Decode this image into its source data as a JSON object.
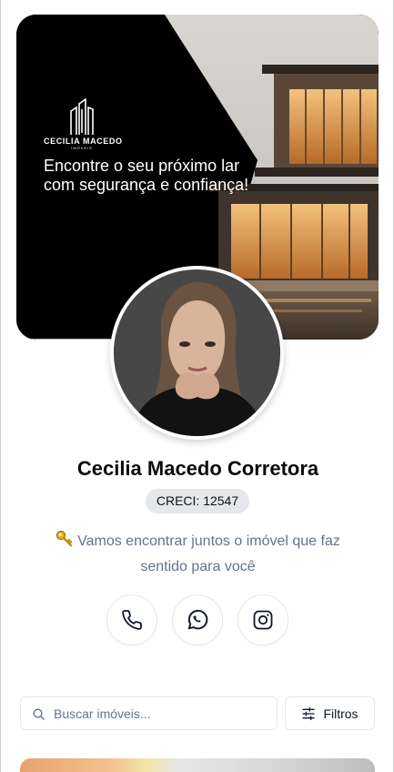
{
  "profile": {
    "name": "Cecilia Macedo Corretora",
    "creci": "CRECI: 12547",
    "bio": "Vamos encontrar juntos o imóvel que faz sentido para você",
    "bio_icon": "key-icon"
  },
  "banner": {
    "logo_name": "CECILIA MACEDO",
    "logo_sub": "IMÓVEIS",
    "tagline": "Encontre o seu próximo lar com segurança e confiança!"
  },
  "social": [
    {
      "name": "phone",
      "icon": "phone-icon"
    },
    {
      "name": "whatsapp",
      "icon": "whatsapp-icon"
    },
    {
      "name": "instagram",
      "icon": "instagram-icon"
    }
  ],
  "search": {
    "placeholder": "Buscar imóveis...",
    "filters_label": "Filtros"
  },
  "colors": {
    "banner_bg": "#000000",
    "accent_text": "#0f172a",
    "muted_text": "#64748b",
    "badge_bg": "#e5e7eb"
  }
}
